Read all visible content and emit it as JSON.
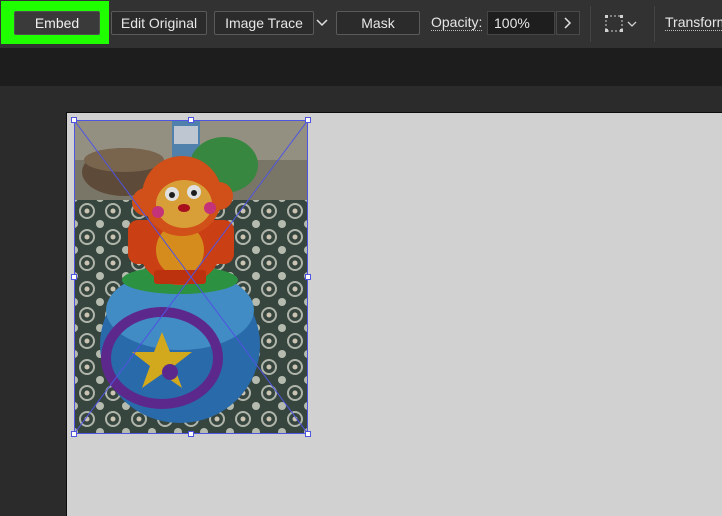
{
  "control_bar": {
    "embed_label": "Embed",
    "edit_original_label": "Edit Original",
    "image_trace_label": "Image Trace",
    "mask_label": "Mask",
    "opacity_label": "Opacity:",
    "opacity_value": "100%",
    "transform_label": "Transform",
    "highlight_color": "#1fff00"
  },
  "icons": [
    "chevron-down-icon",
    "chevron-right-icon",
    "align-to-selection-icon"
  ],
  "canvas": {
    "image_description": "placed-photo-toy"
  }
}
